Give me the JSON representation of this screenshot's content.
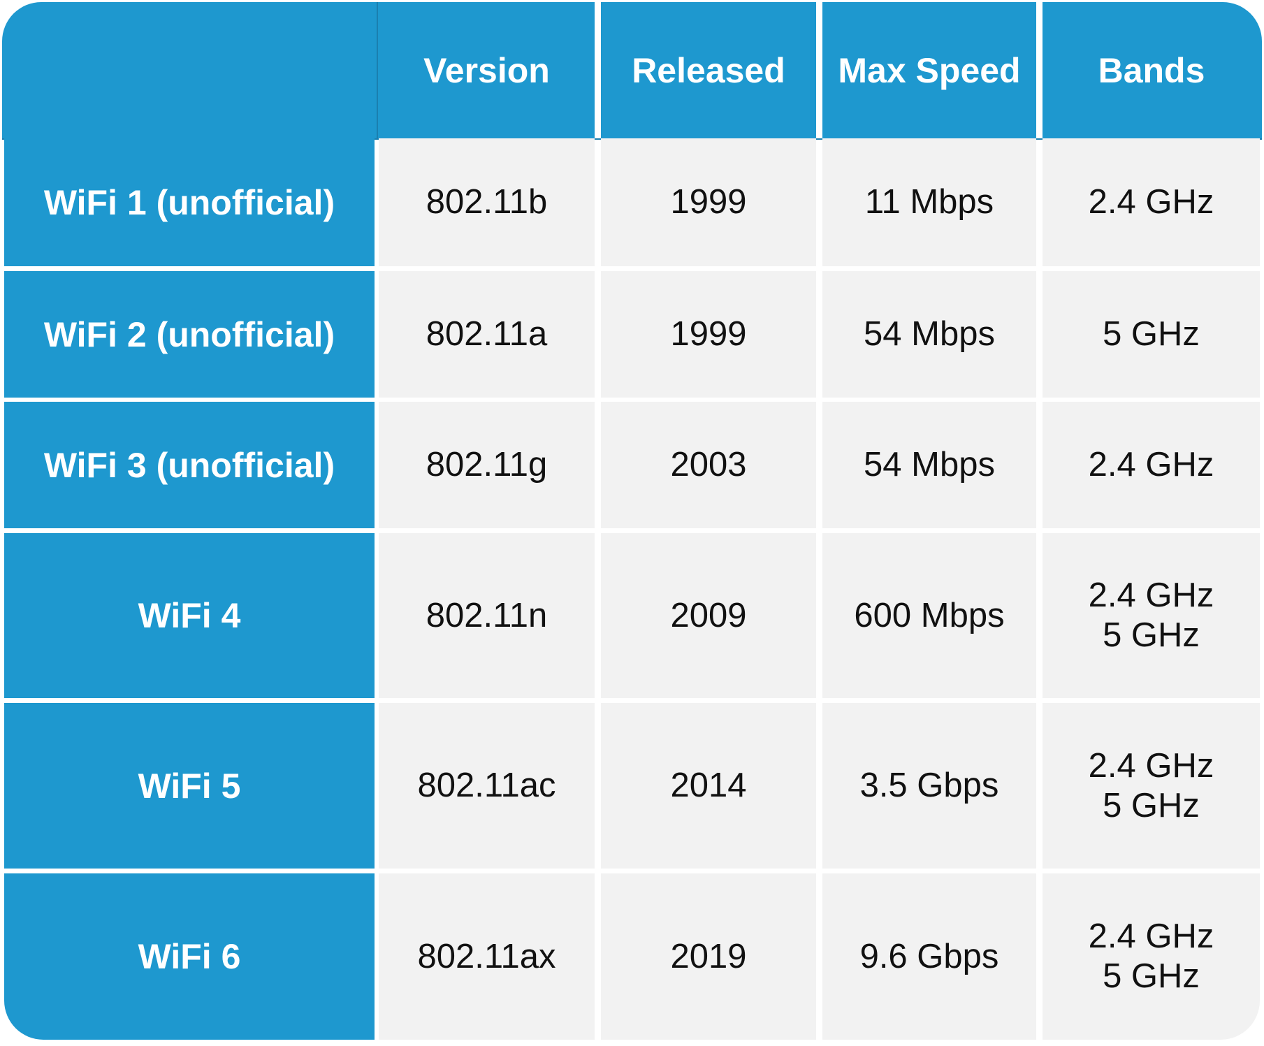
{
  "table": {
    "columns": [
      "",
      "Version",
      "Released",
      "Max Speed",
      "Bands"
    ],
    "rows": [
      {
        "name": "WiFi 1 (unofficial)",
        "version": "802.11b",
        "released": "1999",
        "max_speed": "11 Mbps",
        "bands": [
          "2.4 GHz"
        ]
      },
      {
        "name": "WiFi 2 (unofficial)",
        "version": "802.11a",
        "released": "1999",
        "max_speed": "54 Mbps",
        "bands": [
          "5 GHz"
        ]
      },
      {
        "name": "WiFi 3 (unofficial)",
        "version": "802.11g",
        "released": "2003",
        "max_speed": "54 Mbps",
        "bands": [
          "2.4 GHz"
        ]
      },
      {
        "name": "WiFi 4",
        "version": "802.11n",
        "released": "2009",
        "max_speed": "600 Mbps",
        "bands": [
          "2.4 GHz",
          "5 GHz"
        ]
      },
      {
        "name": "WiFi 5",
        "version": "802.11ac",
        "released": "2014",
        "max_speed": "3.5 Gbps",
        "bands": [
          "2.4 GHz",
          "5 GHz"
        ]
      },
      {
        "name": "WiFi 6",
        "version": "802.11ax",
        "released": "2019",
        "max_speed": "9.6 Gbps",
        "bands": [
          "2.4 GHz",
          "5 GHz"
        ]
      }
    ]
  },
  "colors": {
    "header_bg": "#1e98cf",
    "cell_bg": "#f2f2f2",
    "header_text": "#ffffff",
    "cell_text": "#111111"
  }
}
